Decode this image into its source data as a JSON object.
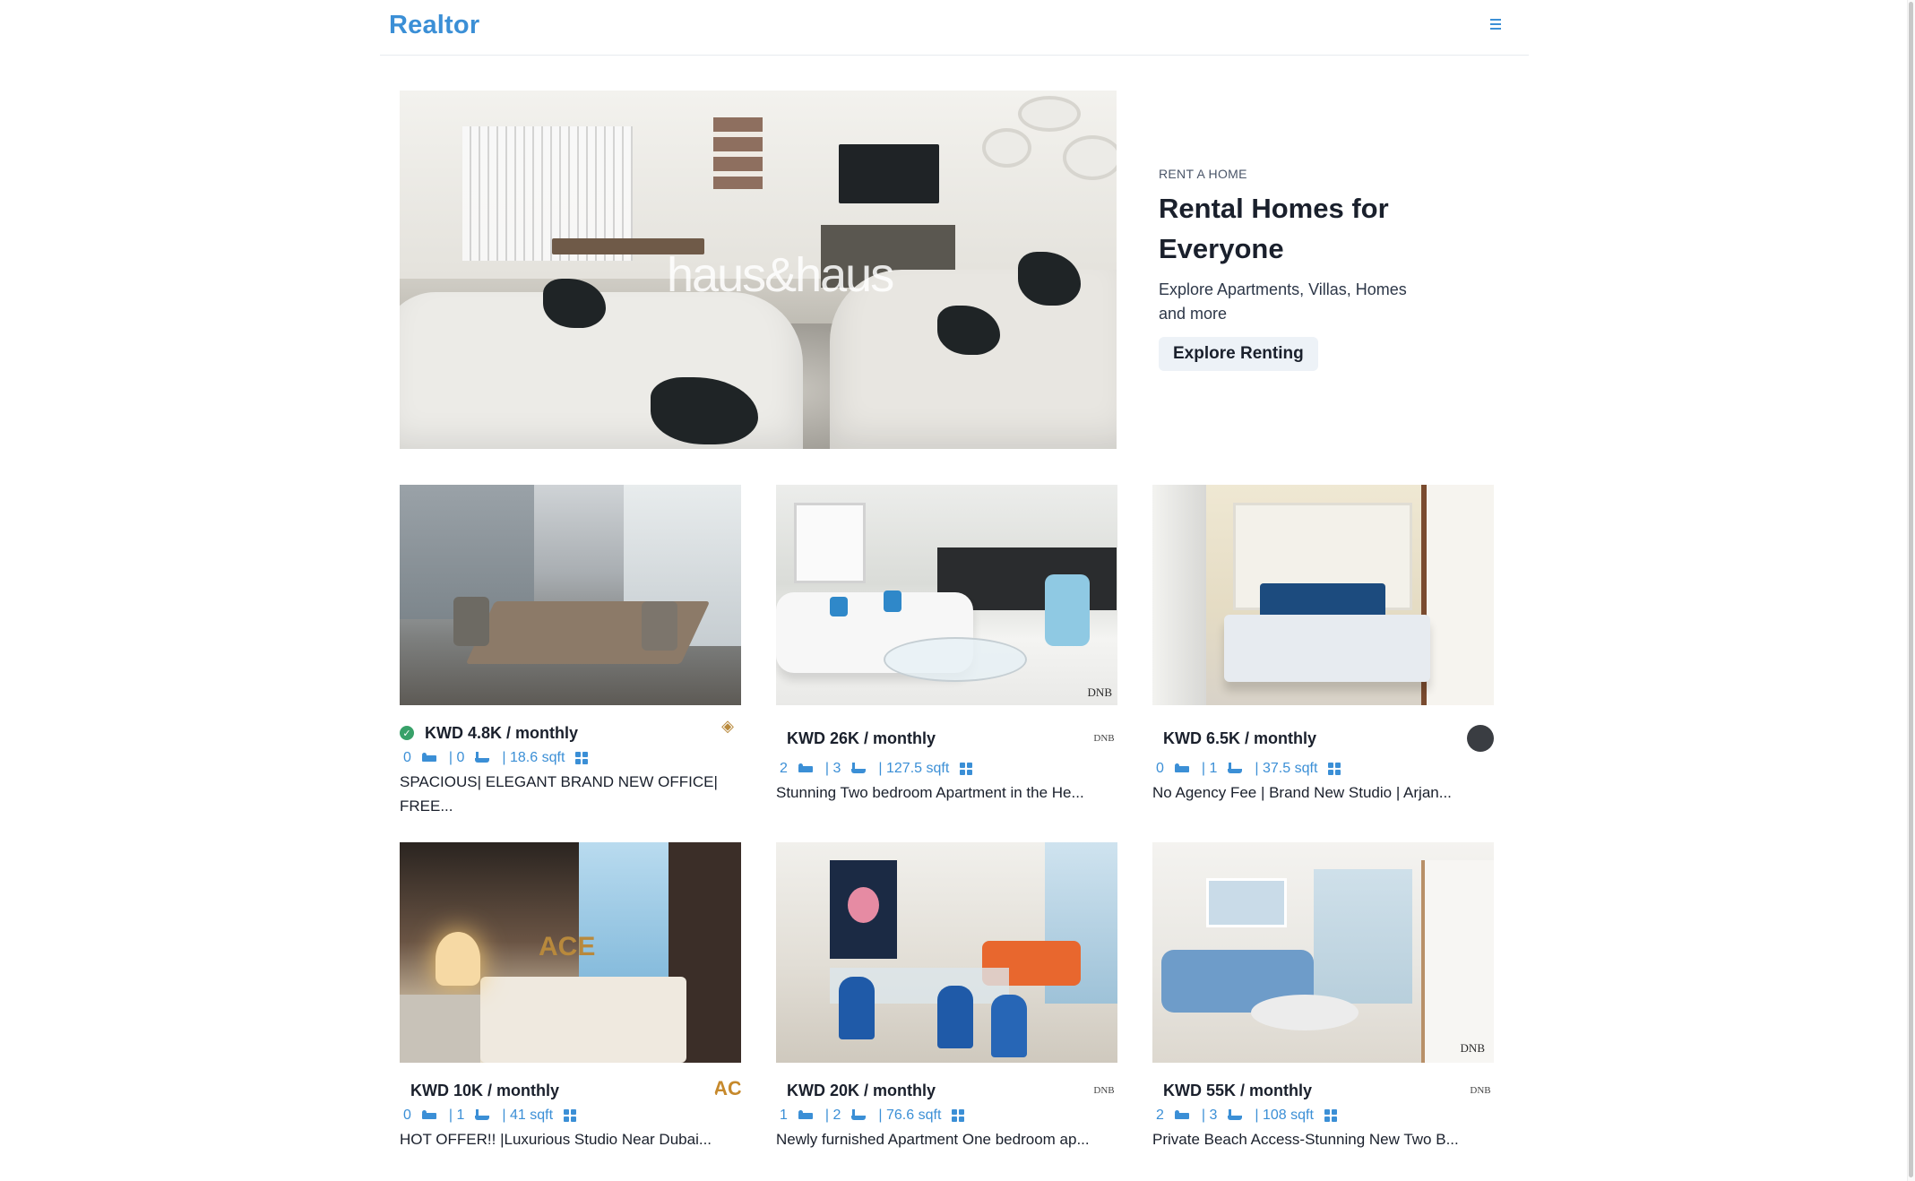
{
  "navbar": {
    "logo": "Realtor",
    "menu_icon": "hamburger-menu-icon"
  },
  "hero": {
    "image_watermark": "haus&haus",
    "eyebrow": "RENT A HOME",
    "title_line1": "Rental Homes for",
    "title_line2": "Everyone",
    "desc_line1": "Explore Apartments, Villas, Homes",
    "desc_line2": "and more",
    "button": "Explore Renting"
  },
  "listings": [
    {
      "price": "KWD 4.8K / monthly",
      "verified": true,
      "rooms": "0",
      "baths": "| 0",
      "area": "| 18.6 sqft",
      "title_line1": "SPACIOUS| ELEGANT BRAND NEW OFFICE|",
      "title_line2": "FREE...",
      "agency_logo": "agency-logo-gold"
    },
    {
      "price": "KWD 26K / monthly",
      "verified": false,
      "rooms": "2",
      "baths": "| 3",
      "area": "| 127.5 sqft",
      "title_line1": "Stunning Two bedroom Apartment in the He...",
      "title_line2": "",
      "agency_logo": "agency-logo-dnb",
      "agency_text": "DNB"
    },
    {
      "price": "KWD 6.5K / monthly",
      "verified": false,
      "rooms": "0",
      "baths": "| 1",
      "area": "| 37.5 sqft",
      "title_line1": "No Agency Fee | Brand New Studio | Arjan...",
      "title_line2": "",
      "agency_logo": "agency-logo-dark"
    },
    {
      "price": "KWD 10K / monthly",
      "verified": false,
      "rooms": "0",
      "baths": "| 1",
      "area": "| 41 sqft",
      "title_line1": "HOT OFFER!! |Luxurious Studio Near Dubai...",
      "title_line2": "",
      "agency_logo": "agency-logo-ace",
      "agency_text": "AC",
      "photo_watermark": "ACE"
    },
    {
      "price": "KWD 20K / monthly",
      "verified": false,
      "rooms": "1",
      "baths": "| 2",
      "area": "| 76.6 sqft",
      "title_line1": "Newly furnished Apartment One bedroom ap...",
      "title_line2": "",
      "agency_logo": "agency-logo-dnb",
      "agency_text": "DNB"
    },
    {
      "price": "KWD 55K / monthly",
      "verified": false,
      "rooms": "2",
      "baths": "| 3",
      "area": "| 108 sqft",
      "title_line1": "Private Beach Access-Stunning New Two B...",
      "title_line2": "",
      "agency_logo": "agency-logo-dnb",
      "agency_text": "DNB"
    }
  ],
  "colors": {
    "brand": "#3b8fd6",
    "verified": "#38a169",
    "text": "#1a202c"
  }
}
